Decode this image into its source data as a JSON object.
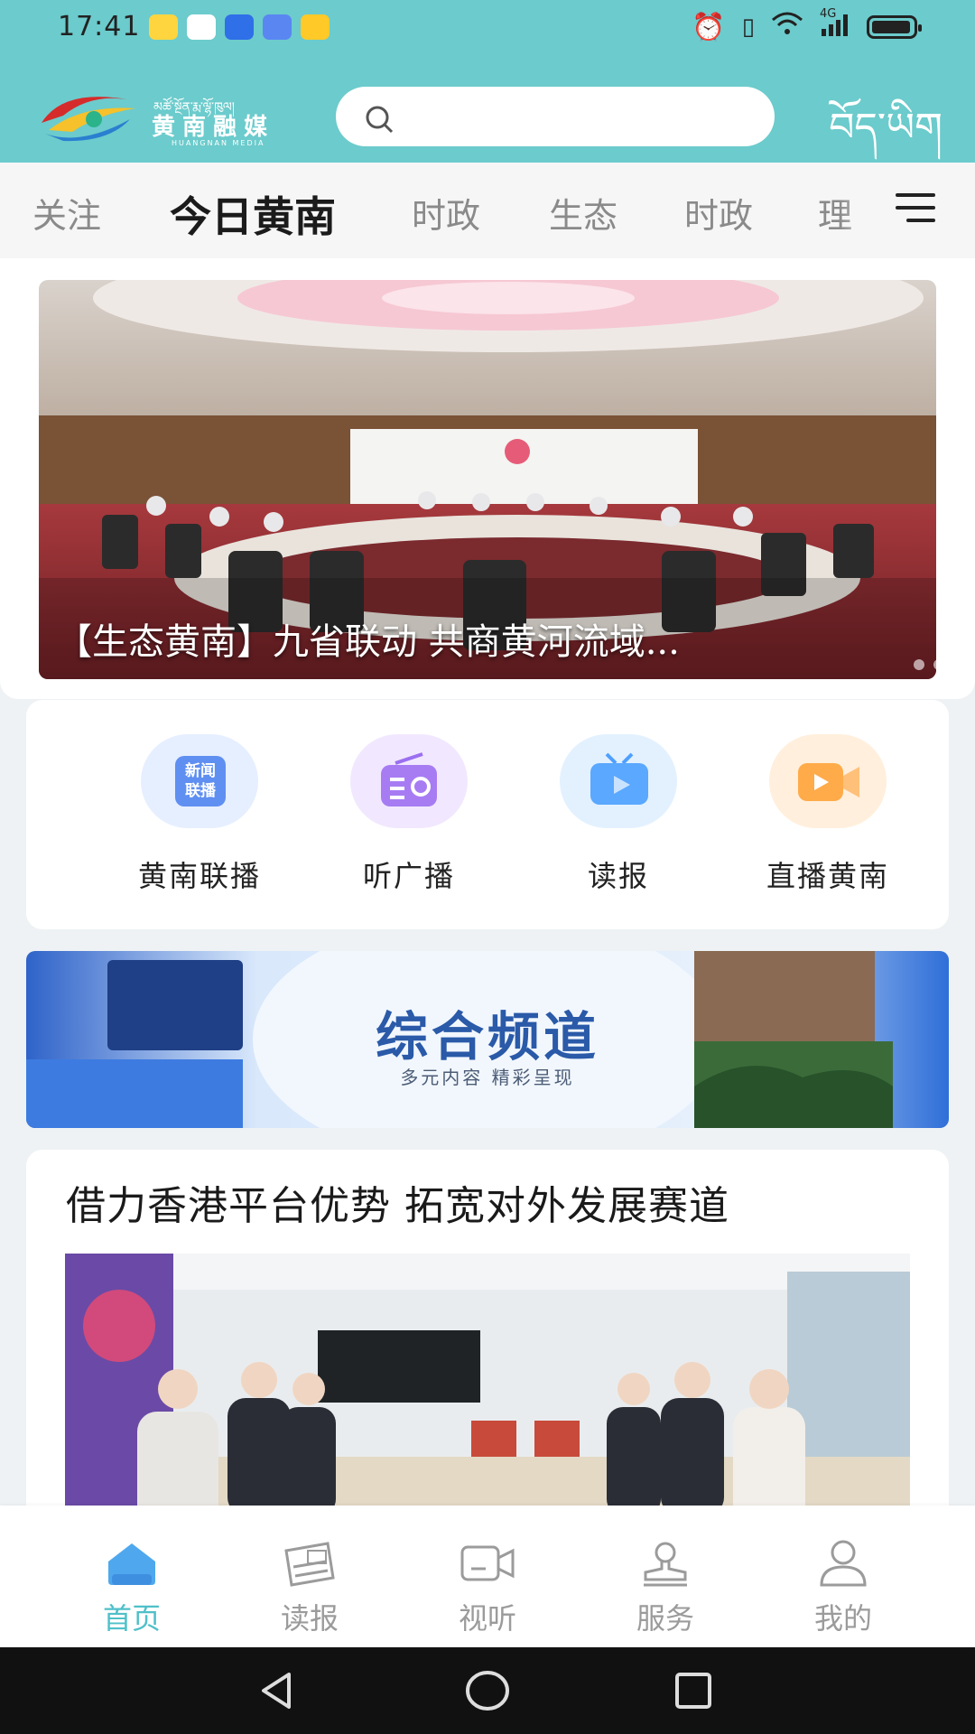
{
  "status_bar": {
    "time": "17:41",
    "network": "4G"
  },
  "header": {
    "logo_text": "黄南融媒",
    "logo_subtext": "HUANGNAN MEDIA",
    "logo_tibetan": "མཚོ་སྔོན་རྨ་ལྷོ་ཁུལ།",
    "search_placeholder": "",
    "language_toggle": "བོད་ཡིག"
  },
  "tabs": [
    {
      "label": "关注",
      "active": false
    },
    {
      "label": "今日黄南",
      "active": true
    },
    {
      "label": "时政",
      "active": false
    },
    {
      "label": "生态",
      "active": false
    },
    {
      "label": "时政",
      "active": false
    },
    {
      "label": "理",
      "active": false
    }
  ],
  "hero": {
    "caption": "【生态黄南】九省联动 共商黄河流域..."
  },
  "quick_access": [
    {
      "label": "黄南联播",
      "icon": "news-broadcast-icon",
      "badge_text": "新闻\n联播",
      "color": "#5f8ff1"
    },
    {
      "label": "听广播",
      "icon": "radio-icon",
      "color": "#9b6ff0"
    },
    {
      "label": "读报",
      "icon": "tv-icon",
      "color": "#4ea0ff"
    },
    {
      "label": "直播黄南",
      "icon": "video-camera-icon",
      "color": "#ffa54a"
    }
  ],
  "banner": {
    "title": "综合频道",
    "subtitle": "多元内容 精彩呈现"
  },
  "news": {
    "title": "借力香港平台优势 拓宽对外发展赛道"
  },
  "bottom_nav": [
    {
      "label": "首页",
      "icon": "home-icon",
      "active": true
    },
    {
      "label": "读报",
      "icon": "newspaper-icon",
      "active": false
    },
    {
      "label": "视听",
      "icon": "video-icon",
      "active": false
    },
    {
      "label": "服务",
      "icon": "service-icon",
      "active": false
    },
    {
      "label": "我的",
      "icon": "profile-icon",
      "active": false
    }
  ],
  "colors": {
    "header": "#6ccbcc",
    "accent": "#4fc0c9"
  }
}
